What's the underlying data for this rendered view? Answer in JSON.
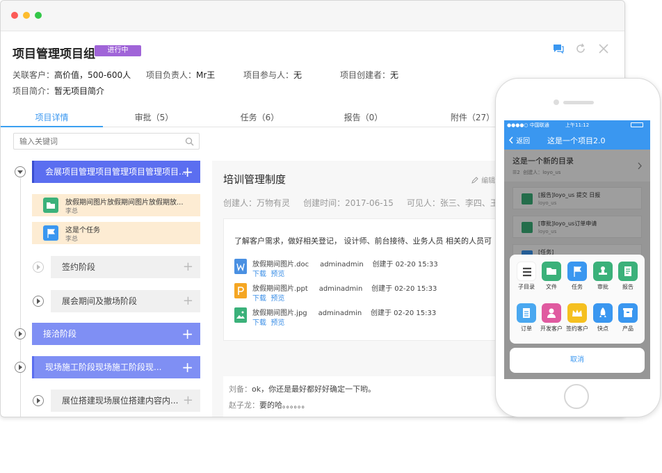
{
  "project": {
    "title": "项目管理项目组",
    "status": "进行中",
    "customer_label": "关联客户：",
    "customer_value": "高价值，500-600人",
    "owner_label": "项目负责人：",
    "owner_value": "Mr王",
    "participants_label": "项目参与人：",
    "participants_value": "无",
    "creator_label": "项目创建者：",
    "creator_value": "无",
    "intro_label": "项目简介：",
    "intro_value": "暂无项目简介"
  },
  "tabs": [
    "项目详情",
    "审批（5）",
    "任务（6）",
    "报告（0）",
    "附件（27）"
  ],
  "search": {
    "placeholder": "输入关键词"
  },
  "tree": {
    "stage1": "会展项目管理项目管理项目管理项目...",
    "task1_title": "放假期间图片放假期间图片放假期放...",
    "task1_user": "李总",
    "task2_title": "这是个任务",
    "task2_user": "李总",
    "sub1": "签约阶段",
    "sub2": "展会期间及撤场阶段",
    "stage2": "接洽阶段",
    "stage3": "现场施工阶段现场施工阶段现...",
    "sub3": "展位搭建现场展位搭建内容内...",
    "plus": "+"
  },
  "doc": {
    "title": "培训管理制度",
    "edit": "编辑",
    "meta_creator": "创建人：万物有灵",
    "meta_time": "创建时间：2017-06-15",
    "meta_visible": "可见人：张三、李四、王麻子",
    "body": "了解客户需求，做好相关登记， 设计师、前台接待、业务人员 相关的人员可",
    "download": "下载",
    "preview": "预览",
    "attachments": [
      {
        "name": "放假期间图片.doc",
        "user": "adminadmin",
        "time": "创建于 02-20 15:33",
        "color": "#4a90e2"
      },
      {
        "name": "放假期间图片.ppt",
        "user": "adminadmin",
        "time": "创建于 02-20 15:33",
        "color": "#f5a623"
      },
      {
        "name": "放假期间图片.jpg",
        "user": "adminadmin",
        "time": "创建于 02-20 15:33",
        "color": "#3bb17a"
      }
    ]
  },
  "chat": [
    {
      "name": "刘备：",
      "text": "ok，你还是最好都好好确定一下哟。"
    },
    {
      "name": "赵子龙：",
      "text": "要的哈。。。。。。"
    }
  ],
  "mobile": {
    "carrier": "●●●●○ 中国联通",
    "time": "上午11:12",
    "back": "返回",
    "nav_title": "这是一个项目2.0",
    "dir_title": "这是一个新的目录",
    "dir_count": "2",
    "dir_creator": "创建人：loyo_us",
    "items": [
      {
        "text": "[报告]loyo_us 提交 日报",
        "user": "loyo_us"
      },
      {
        "text": "[审批]loyo_us订单申请",
        "user": "loyo_us"
      },
      {
        "text": "[任务]",
        "user": ""
      }
    ],
    "actions": [
      {
        "label": "子目录",
        "color": "#ffffff"
      },
      {
        "label": "文件",
        "color": "#3bb17a"
      },
      {
        "label": "任务",
        "color": "#3a97f0"
      },
      {
        "label": "审批",
        "color": "#3bb17a"
      },
      {
        "label": "报告",
        "color": "#3bb17a"
      },
      {
        "label": "订单",
        "color": "#4aa8f0"
      },
      {
        "label": "开发客户",
        "color": "#e05aa0"
      },
      {
        "label": "签约客户",
        "color": "#f5c020"
      },
      {
        "label": "快点",
        "color": "#3a97f0"
      },
      {
        "label": "产品",
        "color": "#3a97f0"
      }
    ],
    "cancel": "取消"
  },
  "colors": {
    "accent_blue": "#3a97f0",
    "stage_blue": "#5b6ef0",
    "stage_light": "#7f8ff4",
    "badge_purple": "#a064d8"
  }
}
